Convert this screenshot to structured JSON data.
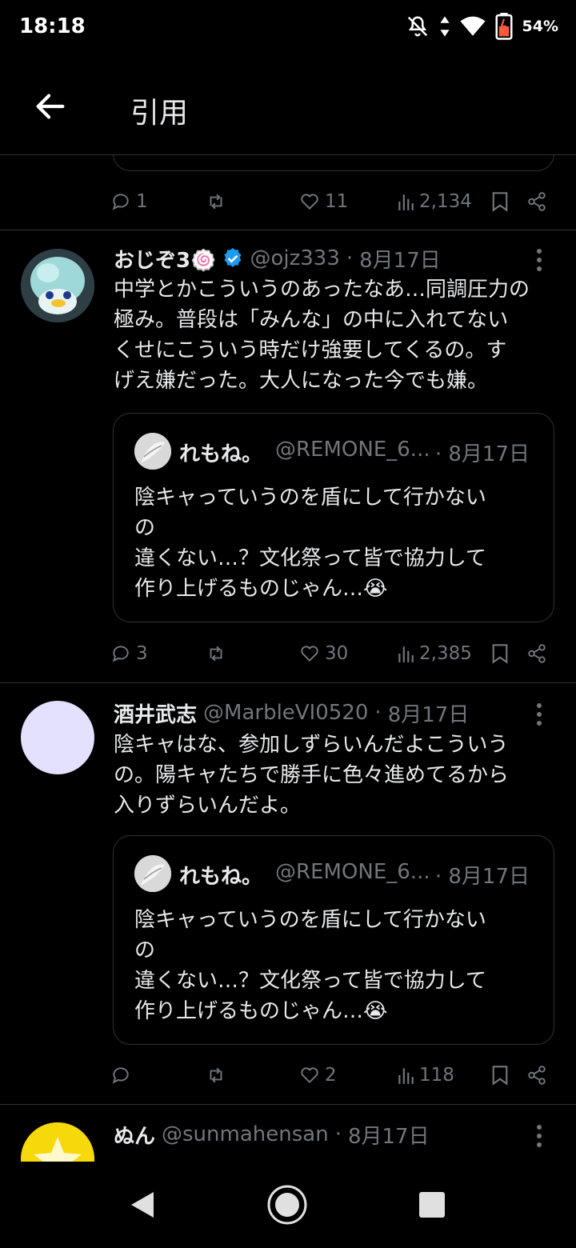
{
  "status": {
    "time": "18:18",
    "battery": "54%"
  },
  "header": {
    "title": "引用"
  },
  "top_partial": {
    "reply_count": "1",
    "retweet_count": "",
    "like_count": "11",
    "view_count": "2,134"
  },
  "tweets": [
    {
      "name": "おじぞ3🍥",
      "handle": "@ojz333",
      "dot": "·",
      "date": "8月17日",
      "text_lines": [
        "中学とかこういうのあったなあ…同調圧力の",
        "極み。普段は「みんな」の中に入れてない",
        "くせにこういう時だけ強要してくるの。す",
        "げえ嫌だった。大人になった今でも嫌。"
      ],
      "quote": {
        "name": "れもね。",
        "handle": "@REMONE_6...",
        "date": "· 8月17日",
        "text_lines": [
          "陰キャっていうのを盾にして行かない",
          "の",
          "違くない…？文化祭って皆で協力して",
          "作り上げるものじゃん…😭"
        ]
      },
      "reply_count": "3",
      "like_count": "30",
      "view_count": "2,385"
    },
    {
      "name": "酒井武志",
      "handle": "@MarbleVI0520",
      "dot": "·",
      "date": "8月17日",
      "text_lines": [
        "陰キャはな、参加しずらいんだよこういう",
        "の。陽キャたちで勝手に色々進めてるから",
        "入りずらいんだよ。"
      ],
      "quote": {
        "name": "れもね。",
        "handle": "@REMONE_6...",
        "date": "· 8月17日",
        "text_lines": [
          "陰キャっていうのを盾にして行かない",
          "の",
          "違くない…？文化祭って皆で協力して",
          "作り上げるものじゃん…😭"
        ]
      },
      "reply_count": "",
      "like_count": "2",
      "view_count": "118"
    },
    {
      "name": "ぬん",
      "handle": "@sunmahensan",
      "dot": "·",
      "date": "8月17日"
    }
  ],
  "colors": {
    "background": "#000000",
    "text": "#e7e9ea",
    "muted": "#71767b",
    "divider": "#2f3336",
    "verified": "#1d9bf0",
    "avatar_lavender": "#e4e0ff"
  }
}
